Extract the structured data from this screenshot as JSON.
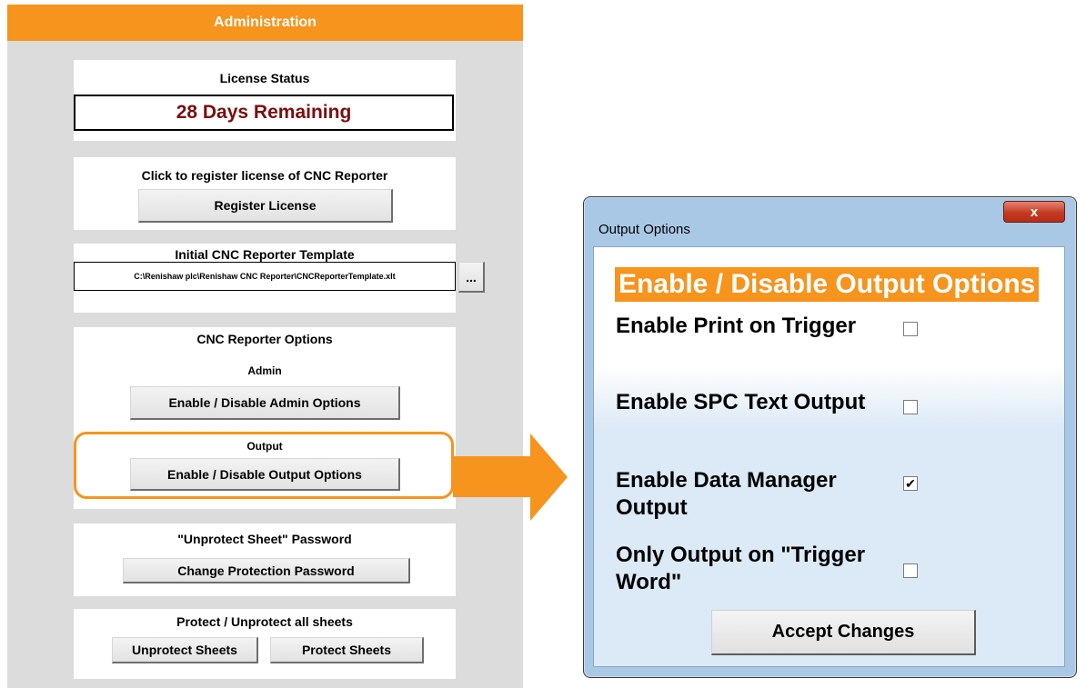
{
  "admin": {
    "title": "Administration",
    "license": {
      "heading": "License Status",
      "status": "28 Days Remaining"
    },
    "register": {
      "heading": "Click to register license of CNC Reporter",
      "button": "Register License"
    },
    "template": {
      "heading": "Initial CNC Reporter Template",
      "path": "C:\\Renishaw plc\\Renishaw CNC Reporter\\CNCReporterTemplate.xlt",
      "browse_button": "..."
    },
    "options": {
      "heading": "CNC Reporter Options",
      "admin_label": "Admin",
      "admin_button": "Enable / Disable Admin Options",
      "output_label": "Output",
      "output_button": "Enable / Disable Output Options"
    },
    "password": {
      "heading": "\"Unprotect Sheet\" Password",
      "button": "Change Protection Password"
    },
    "protect": {
      "heading": "Protect / Unprotect all sheets",
      "unprotect_button": "Unprotect Sheets",
      "protect_button": "Protect Sheets"
    }
  },
  "dialog": {
    "title": "Output Options",
    "close_label": "x",
    "heading": "Enable / Disable Output Options",
    "options": [
      {
        "label": "Enable Print on Trigger",
        "checked": false
      },
      {
        "label": "Enable SPC Text Output",
        "checked": false
      },
      {
        "label": "Enable Data Manager Output",
        "checked": true
      },
      {
        "label": "Only Output on \"Trigger Word\"",
        "checked": false
      }
    ],
    "accept_button": "Accept Changes"
  },
  "colors": {
    "accent": "#f7941d",
    "license_text": "#7b0e0e",
    "panel_bg": "#dcdcdc",
    "dialog_frame": "#a9c8e6",
    "close_button": "#c43b22"
  }
}
